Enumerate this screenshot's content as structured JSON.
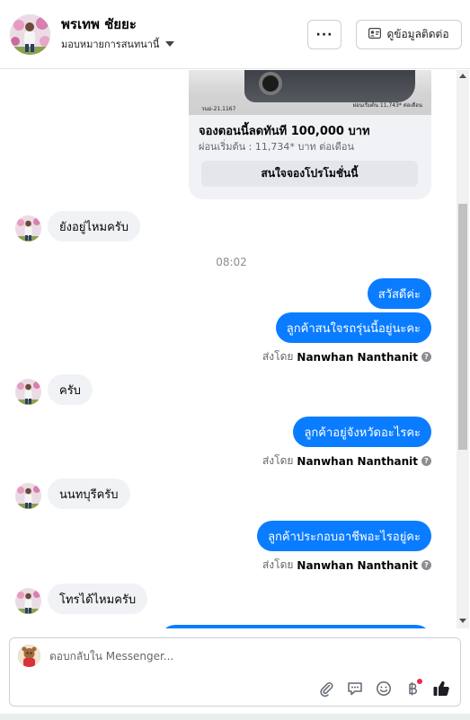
{
  "header": {
    "contact_name": "พรเทพ ชัยยะ",
    "assign_label": "มอบหมายการสนทนานี้",
    "more_label": "···",
    "contact_info_label": "ดูข้อมูลติดต่อ"
  },
  "card": {
    "image_left_text": "วนม่-21.1167",
    "image_right_text": "ผ่อนเริ่มต้น 11,743* ต่อเดือน",
    "title": "จองตอนนี้ลดทันที 100,000 บาท",
    "subtitle": "ผ่อนเริ่มต้น : 11,734* บาท ต่อเดือน",
    "button_label": "สนใจจองโปรโมชั่นนี้"
  },
  "messages": {
    "in_1": "ยังอยู่ไหมครับ",
    "timestamp": "08:02",
    "out_1": "สวัสดีค่ะ",
    "out_2": "ลูกค้าสนใจรถรุ่นนี้อยู่นะคะ",
    "in_2": "ครับ",
    "out_3": "ลูกค้าอยู่จังหวัดอะไรคะ",
    "in_3": "นนทบุรีครับ",
    "out_4": "ลูกค้าประกอบอาชีพอะไรอยู่คะ",
    "in_4": "โทรได้ไหมครับ"
  },
  "sent_by": {
    "prefix": "ส่งโดย",
    "name": "Nanwhan Nanthanit"
  },
  "composer": {
    "placeholder": "ตอบกลับใน Messenger..."
  },
  "colors": {
    "outgoing_bubble": "#0a7cff",
    "incoming_bubble": "#f0f2f5",
    "brand_blue": "#0a7cff",
    "badge_red": "#f02849"
  },
  "icons": {
    "more": "more-horizontal-icon",
    "contact_card": "contact-card-icon",
    "dropdown": "caret-down-icon",
    "attach": "paperclip-icon",
    "saved_replies": "chat-bubble-icon",
    "emoji": "smiley-icon",
    "payment": "baht-icon",
    "like": "thumbs-up-icon",
    "help": "question-circle-icon"
  }
}
